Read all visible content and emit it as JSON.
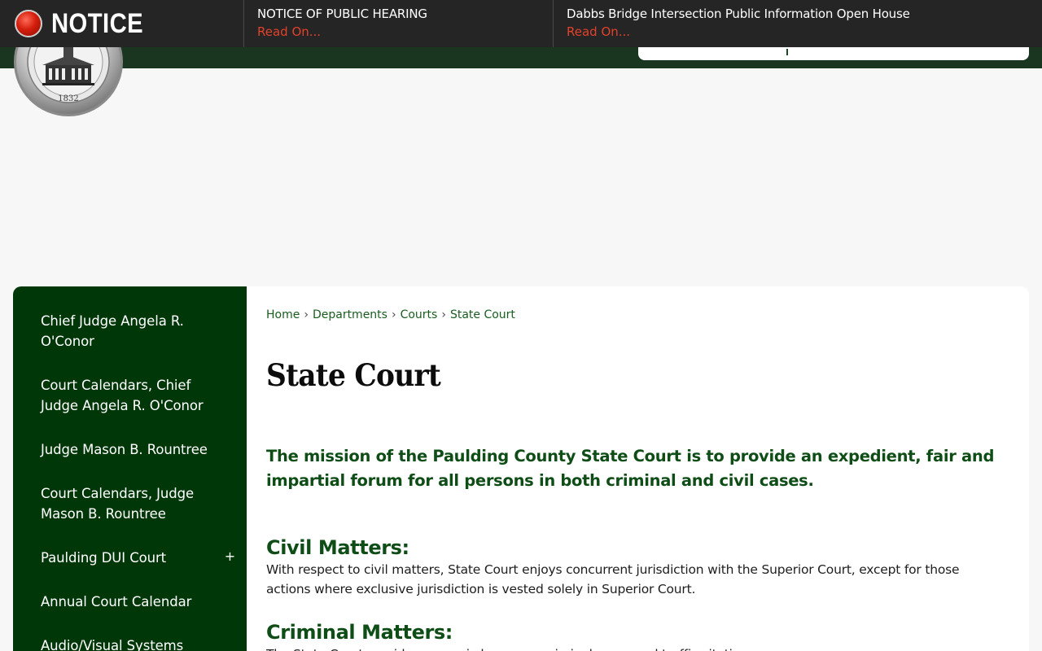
{
  "notice_bar": {
    "label": "NOTICE",
    "items": [
      {
        "title": "NOTICE OF PUBLIC HEARING",
        "link": "Read On..."
      },
      {
        "title": "Dabbs Bridge Intersection Public Information Open House",
        "link": "Read On..."
      }
    ]
  },
  "seal": {
    "year": "1832"
  },
  "sidebar": {
    "items": [
      {
        "label": "Chief Judge Angela R. O'Conor"
      },
      {
        "label": "Court Calendars, Chief Judge Angela R. O'Conor"
      },
      {
        "label": "Judge Mason B. Rountree"
      },
      {
        "label": "Court Calendars, Judge Mason B. Rountree"
      },
      {
        "label": "Paulding DUI Court",
        "expander": "+"
      },
      {
        "label": "Annual Court Calendar"
      },
      {
        "label": "Audio/Visual Systems"
      }
    ]
  },
  "breadcrumb": [
    "Home",
    "Departments",
    "Courts",
    "State Court"
  ],
  "breadcrumb_separator": "›",
  "page": {
    "title": "State Court",
    "mission": "The mission of the Paulding County State Court is to provide an expedient, fair and impartial forum for all persons in both criminal and civil cases.",
    "civil_heading": "Civil Matters:",
    "civil_body": "With respect to civil matters,  State Court enjoys concurrent jurisdiction with the Superior Court, except for those actions where exclusive jurisdiction is vested solely in Superior Court.",
    "criminal_heading": "Criminal Matters:",
    "criminal_body": "The State Court presides over misdemeanor criminal cases and traffic citations."
  },
  "colors": {
    "notice_bar": "#252525",
    "link_red": "#e2412b",
    "sidebar_green": "#003709",
    "heading_green": "#0f4d17",
    "header_green": "#1a3520"
  }
}
